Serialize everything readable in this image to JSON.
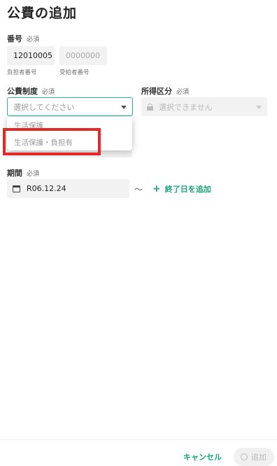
{
  "page": {
    "title": "公費の追加"
  },
  "number": {
    "label": "番号",
    "required": "必須",
    "payer_value": "12010005",
    "payer_caption": "負担者番号",
    "recipient_placeholder": "0000000",
    "recipient_caption": "受給者番号"
  },
  "system": {
    "label": "公費制度",
    "required": "必須",
    "placeholder": "選択してください",
    "options": [
      "生活保護",
      "生活保護・負担有"
    ]
  },
  "income": {
    "label": "所得区分",
    "required": "必須",
    "placeholder": "選択できません"
  },
  "period": {
    "label": "期間",
    "required": "必須",
    "start_date": "R06.12.24",
    "separator": "～",
    "add_end_label": "終了日を追加"
  },
  "footer": {
    "cancel_label": "キャンセル",
    "add_label": "追加"
  }
}
